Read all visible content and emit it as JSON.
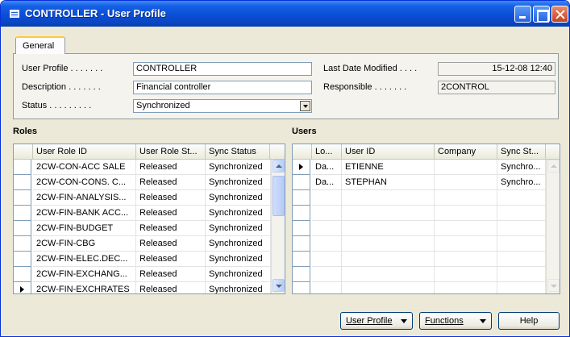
{
  "window": {
    "title": "CONTROLLER - User Profile",
    "controls": [
      "minimize",
      "maximize",
      "close"
    ]
  },
  "tabs": [
    {
      "label": "General",
      "active": true
    }
  ],
  "general": {
    "user_profile_label": "User Profile . . . . . . .",
    "user_profile_value": "CONTROLLER",
    "description_label": "Description . . . . . . .",
    "description_value": "Financial controller",
    "status_label": "Status . . . . . . . . .",
    "status_value": "Synchronized",
    "last_modified_label": "Last Date Modified . . . .",
    "last_modified_value": "15-12-08 12:40",
    "responsible_label": "Responsible . . . . . . .",
    "responsible_value": "2CONTROL"
  },
  "roles": {
    "title": "Roles",
    "columns": [
      "User Role ID",
      "User Role St...",
      "Sync Status"
    ],
    "rows": [
      [
        "2CW-CON-ACC SALE",
        "Released",
        "Synchronized"
      ],
      [
        "2CW-CON-CONS. C...",
        "Released",
        "Synchronized"
      ],
      [
        "2CW-FIN-ANALYSIS...",
        "Released",
        "Synchronized"
      ],
      [
        "2CW-FIN-BANK ACC...",
        "Released",
        "Synchronized"
      ],
      [
        "2CW-FIN-BUDGET",
        "Released",
        "Synchronized"
      ],
      [
        "2CW-FIN-CBG",
        "Released",
        "Synchronized"
      ],
      [
        "2CW-FIN-ELEC.DEC...",
        "Released",
        "Synchronized"
      ],
      [
        "2CW-FIN-EXCHANG...",
        "Released",
        "Synchronized"
      ],
      [
        "2CW-FIN-EXCHRATES",
        "Released",
        "Synchronized"
      ]
    ],
    "current_row": 8
  },
  "users": {
    "title": "Users",
    "columns": [
      "Lo...",
      "User ID",
      "Company",
      "Sync St..."
    ],
    "rows": [
      [
        "Da...",
        "ETIENNE",
        "",
        "Synchro..."
      ],
      [
        "Da...",
        "STEPHAN",
        "",
        "Synchro..."
      ],
      [
        "",
        "",
        "",
        ""
      ],
      [
        "",
        "",
        "",
        ""
      ],
      [
        "",
        "",
        "",
        ""
      ],
      [
        "",
        "",
        "",
        ""
      ],
      [
        "",
        "",
        "",
        ""
      ],
      [
        "",
        "",
        "",
        ""
      ],
      [
        "",
        "",
        "",
        ""
      ]
    ],
    "current_row": 0
  },
  "footer": {
    "user_profile_button": "User Profile",
    "functions_button": "Functions",
    "help_button": "Help"
  },
  "colors": {
    "titlebar": "#0a4fd6",
    "window_bg": "#ece9d8",
    "close_button": "#c4421f"
  }
}
